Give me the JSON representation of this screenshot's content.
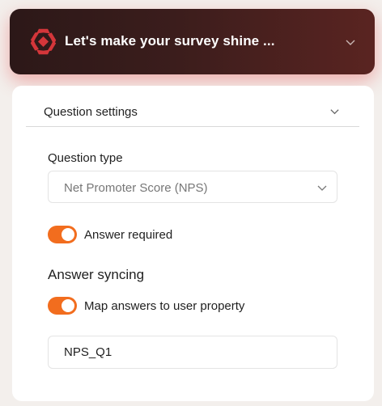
{
  "header": {
    "title": "Let's make your survey shine ...",
    "logo_icon": "brand-logo-icon",
    "expand_icon": "chevron-down-icon"
  },
  "section": {
    "title": "Question settings",
    "expand_icon": "chevron-down-icon"
  },
  "question_type": {
    "label": "Question type",
    "selected": "Net Promoter Score (NPS)"
  },
  "answer_required": {
    "label": "Answer required",
    "enabled": true
  },
  "answer_syncing": {
    "heading": "Answer syncing",
    "toggle_label": "Map answers to user property",
    "enabled": true,
    "property_value": "NPS_Q1"
  },
  "colors": {
    "accent": "#f26d1e",
    "header_bg": "#3b1d1c",
    "logo": "#d4363a"
  }
}
